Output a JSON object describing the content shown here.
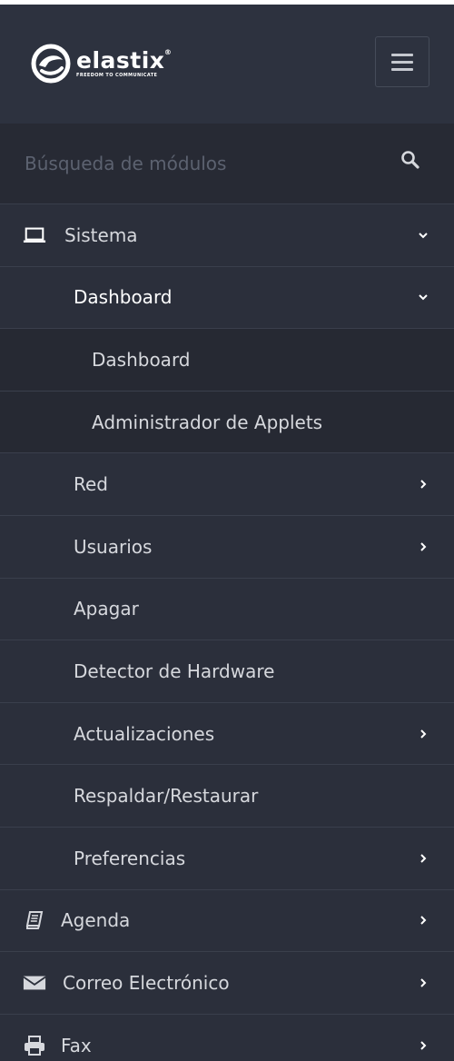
{
  "brand": {
    "name": "elastix",
    "registered_mark": "®",
    "tagline": "FREEDOM TO COMMUNICATE"
  },
  "search": {
    "placeholder": "Búsqueda de módulos",
    "value": ""
  },
  "nav": {
    "sistema": "Sistema",
    "dashboard_group": "Dashboard",
    "dashboard_item": "Dashboard",
    "applets": "Administrador de Applets",
    "red": "Red",
    "usuarios": "Usuarios",
    "apagar": "Apagar",
    "hardware": "Detector de Hardware",
    "actualizaciones": "Actualizaciones",
    "respaldar": "Respaldar/Restaurar",
    "preferencias": "Preferencias",
    "agenda": "Agenda",
    "correo": "Correo Electrónico",
    "fax": "Fax"
  },
  "colors": {
    "sidebar_bg": "#2b2f3b",
    "header_bg": "#2d323f",
    "submenu_bg": "#262933",
    "text": "#d6d8dd"
  }
}
